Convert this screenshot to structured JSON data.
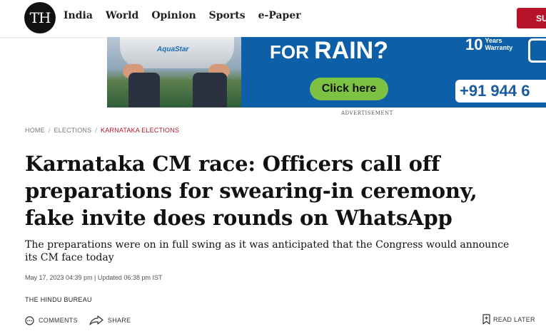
{
  "header": {
    "logo_text": "TH",
    "nav": [
      "India",
      "World",
      "Opinion",
      "Sports",
      "e-Paper"
    ],
    "subscribe_label": "SU"
  },
  "ad": {
    "brand": "AquaStar",
    "headline_prefix": "FOR",
    "headline_main": "RAIN?",
    "cta": "Click here",
    "badge_number": "10",
    "badge_text_1": "Years",
    "badge_text_2": "Warranty",
    "phone": "+91 944 6",
    "label": "ADVERTISEMENT"
  },
  "breadcrumb": [
    "HOME",
    "ELECTIONS",
    "KARNATAKA ELECTIONS"
  ],
  "article": {
    "title": "Karnataka CM race: Officers call off preparations for swearing-in ceremony, fake invite does rounds on WhatsApp",
    "subtitle": "The preparations were on in full swing as it was anticipated that the Congress would announce its CM face today",
    "dateline": "May 17, 2023 04:39 pm | Updated 06:38 pm IST",
    "author": "THE HINDU BUREAU"
  },
  "actions": {
    "comments": "COMMENTS",
    "share": "SHARE",
    "read_later": "READ LATER"
  },
  "colors": {
    "brand_red": "#b7132b",
    "ad_blue": "#0d5fa8",
    "cta_green": "#7dc242"
  }
}
